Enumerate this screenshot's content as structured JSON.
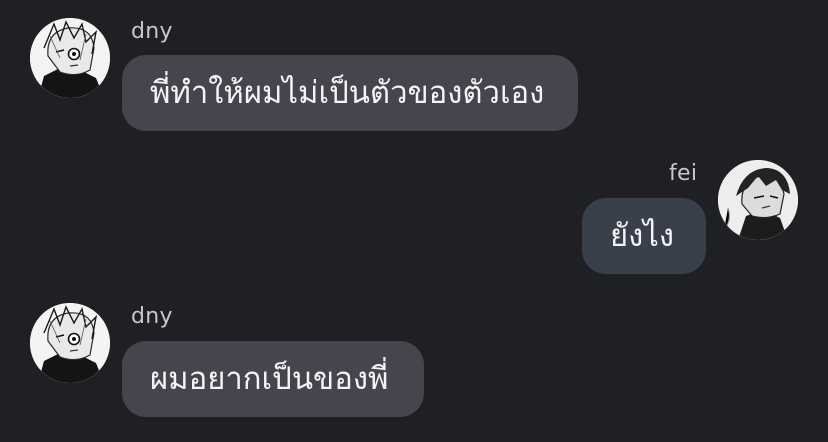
{
  "messages": [
    {
      "sender": "dny",
      "direction": "incoming",
      "text": "พี่ทำให้ผมไม่เป็นตัวของตัวเอง"
    },
    {
      "sender": "fei",
      "direction": "outgoing",
      "text": "ยังไง"
    },
    {
      "sender": "dny",
      "direction": "incoming",
      "text": "ผมอยากเป็นของพี่"
    }
  ],
  "colors": {
    "background": "#1f2024",
    "incoming_bubble": "#45464d",
    "outgoing_bubble": "#3a3f4c",
    "name_text": "#c8c8cc",
    "message_text": "#f4f4f6"
  }
}
